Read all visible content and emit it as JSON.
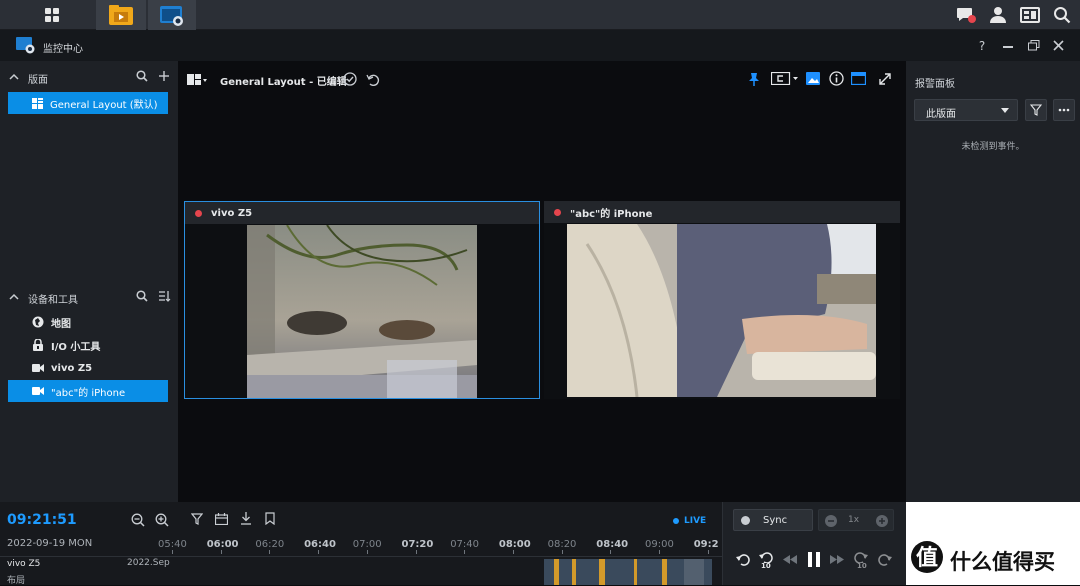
{
  "app": {
    "title": "监控中心"
  },
  "window_controls": [
    "help-icon",
    "minimize-icon",
    "restore-icon",
    "close-icon"
  ],
  "left_panel": {
    "layouts_title": "版面",
    "layouts": [
      {
        "label": "General Layout (默认)",
        "selected": true
      }
    ],
    "devices_title": "设备和工具",
    "devices": [
      {
        "label": "地图",
        "icon": "map-icon",
        "selected": false
      },
      {
        "label": "I/O 小工具",
        "icon": "io-icon",
        "selected": false
      },
      {
        "label": "vivo Z5",
        "icon": "camera-icon",
        "selected": false
      },
      {
        "label": "\"abc\"的 iPhone",
        "icon": "camera-icon",
        "selected": true
      }
    ]
  },
  "toolbar": {
    "layout_title": "General Layout - 已编辑"
  },
  "tiles": [
    {
      "title": "vivo Z5",
      "status": "recording",
      "active": true
    },
    {
      "title": "\"abc\"的 iPhone",
      "status": "recording",
      "active": false
    }
  ],
  "alert_panel": {
    "title": "报警面板",
    "filter_value": "此版面",
    "empty_text": "未检测到事件。"
  },
  "timeline": {
    "time": "09:21:51",
    "date": "2022-09-19 MON",
    "live_label": "LIVE",
    "ticks": [
      {
        "label": "05:40",
        "major": false
      },
      {
        "label": "06:00",
        "major": true
      },
      {
        "label": "06:20",
        "major": false
      },
      {
        "label": "06:40",
        "major": true
      },
      {
        "label": "07:00",
        "major": false
      },
      {
        "label": "07:20",
        "major": true
      },
      {
        "label": "07:40",
        "major": false
      },
      {
        "label": "08:00",
        "major": true
      },
      {
        "label": "08:20",
        "major": false
      },
      {
        "label": "08:40",
        "major": true
      },
      {
        "label": "09:00",
        "major": false
      },
      {
        "label": "09:2",
        "major": true
      }
    ],
    "track_label": "vivo Z5",
    "track_sublabel": "布局",
    "month_label": "2022.Sep"
  },
  "playback": {
    "sync_label": "Sync",
    "speed": "1x",
    "skip_back": "10",
    "skip_fwd": "10"
  },
  "watermark": {
    "text": "什么值得买"
  }
}
